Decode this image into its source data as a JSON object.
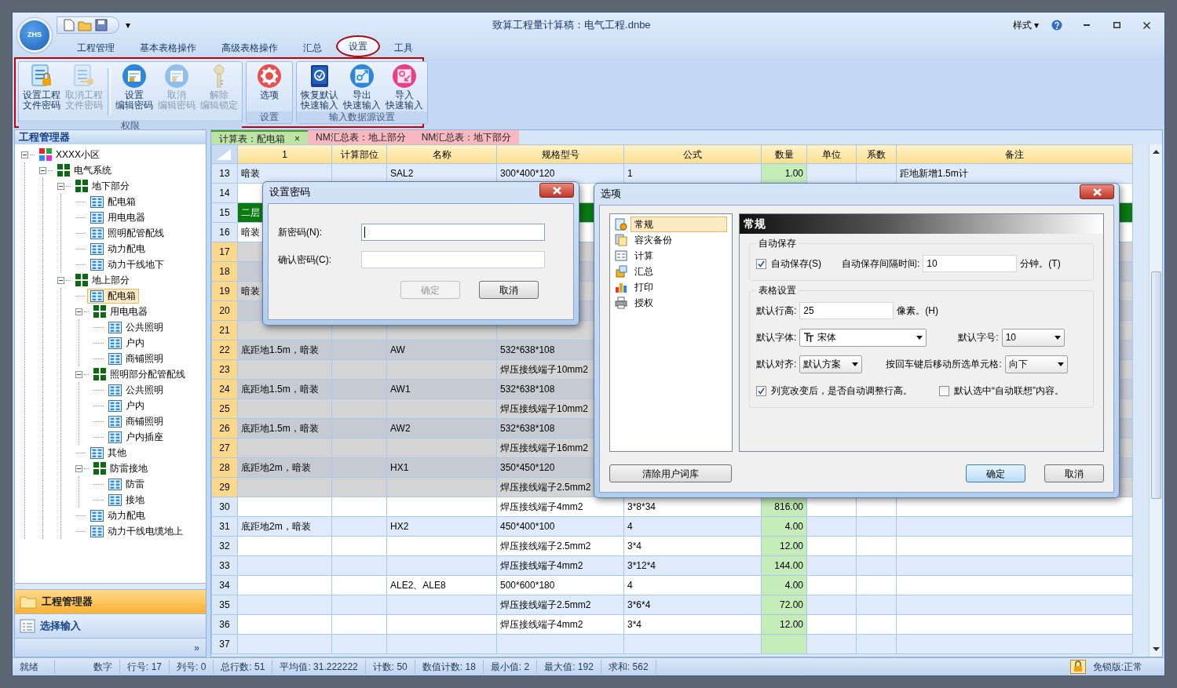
{
  "window": {
    "logo_text": "ZHS",
    "quick_access_more": "▾",
    "title": "致算工程量计算稿：电气工程.dnbe",
    "style_menu": "样式 ▾"
  },
  "ribbon_tabs": [
    {
      "label": "工程管理",
      "selected": false,
      "highlighted": false
    },
    {
      "label": "基本表格操作",
      "selected": false,
      "highlighted": false
    },
    {
      "label": "高级表格操作",
      "selected": false,
      "highlighted": false
    },
    {
      "label": "汇总",
      "selected": false,
      "highlighted": false
    },
    {
      "label": "设置",
      "selected": true,
      "highlighted": true
    },
    {
      "label": "工具",
      "selected": false,
      "highlighted": false
    }
  ],
  "ribbon": {
    "highlighted": true,
    "groups": [
      {
        "label": "权限",
        "buttons": [
          {
            "label": [
              "设置工程",
              "文件密码"
            ],
            "disabled": false
          },
          {
            "label": [
              "取消工程",
              "文件密码"
            ],
            "disabled": true
          },
          {
            "label": [
              "设置",
              "编辑密码"
            ],
            "disabled": false
          },
          {
            "label": [
              "取消",
              "编辑密码"
            ],
            "disabled": true
          },
          {
            "label": [
              "解除",
              "编辑锁定"
            ],
            "disabled": true
          }
        ]
      },
      {
        "label": "设置",
        "buttons": [
          {
            "label": [
              "选项"
            ],
            "disabled": false
          }
        ]
      },
      {
        "label": "输入数据源设置",
        "buttons": [
          {
            "label": [
              "恢复默认",
              "快速输入"
            ],
            "disabled": false
          },
          {
            "label": [
              "导出",
              "快速输入"
            ],
            "disabled": false
          },
          {
            "label": [
              "导入",
              "快速输入"
            ],
            "disabled": false
          }
        ]
      }
    ]
  },
  "sidebar": {
    "title": "工程管理器",
    "tree": [
      {
        "label": "XXXX小区",
        "kind": "project",
        "selected": false,
        "expanded": true,
        "children": [
          {
            "label": "电气系统",
            "kind": "group",
            "selected": false,
            "expanded": true,
            "children": [
              {
                "label": "地下部分",
                "kind": "group",
                "selected": false,
                "expanded": true,
                "children": [
                  {
                    "label": "配电箱",
                    "kind": "sheet",
                    "selected": false
                  },
                  {
                    "label": "用电电器",
                    "kind": "sheet",
                    "selected": false
                  },
                  {
                    "label": "照明配管配线",
                    "kind": "sheet",
                    "selected": false
                  },
                  {
                    "label": "动力配电",
                    "kind": "sheet",
                    "selected": false
                  },
                  {
                    "label": "动力干线地下",
                    "kind": "sheet",
                    "selected": false
                  }
                ]
              },
              {
                "label": "地上部分",
                "kind": "group",
                "selected": false,
                "expanded": true,
                "children": [
                  {
                    "label": "配电箱",
                    "kind": "sheet",
                    "selected": true
                  },
                  {
                    "label": "用电电器",
                    "kind": "group",
                    "selected": false,
                    "expanded": true,
                    "children": [
                      {
                        "label": "公共照明",
                        "kind": "sheet",
                        "selected": false
                      },
                      {
                        "label": "户内",
                        "kind": "sheet",
                        "selected": false
                      },
                      {
                        "label": "商铺照明",
                        "kind": "sheet",
                        "selected": false
                      }
                    ]
                  },
                  {
                    "label": "照明部分配管配线",
                    "kind": "group",
                    "selected": false,
                    "expanded": true,
                    "children": [
                      {
                        "label": "公共照明",
                        "kind": "sheet",
                        "selected": false
                      },
                      {
                        "label": "户内",
                        "kind": "sheet",
                        "selected": false
                      },
                      {
                        "label": "商铺照明",
                        "kind": "sheet",
                        "selected": false
                      },
                      {
                        "label": "户内插座",
                        "kind": "sheet",
                        "selected": false
                      }
                    ]
                  },
                  {
                    "label": "其他",
                    "kind": "sheet",
                    "selected": false
                  },
                  {
                    "label": "防雷接地",
                    "kind": "group",
                    "selected": false,
                    "expanded": true,
                    "children": [
                      {
                        "label": "防雷",
                        "kind": "sheet",
                        "selected": false
                      },
                      {
                        "label": "接地",
                        "kind": "sheet",
                        "selected": false
                      }
                    ]
                  },
                  {
                    "label": "动力配电",
                    "kind": "sheet",
                    "selected": false
                  },
                  {
                    "label": "动力干线电缆地上",
                    "kind": "sheet",
                    "selected": false
                  }
                ]
              }
            ]
          }
        ]
      }
    ],
    "nav": [
      {
        "label": "工程管理器",
        "selected": true
      },
      {
        "label": "选择输入",
        "selected": false
      }
    ],
    "more": "»"
  },
  "sheet_tabs": [
    {
      "label": "计算表：配电箱",
      "color": "#bfe3a5",
      "selected": true,
      "close": "×"
    },
    {
      "label": "NM汇总表：地上部分",
      "color": "#f7b8c0",
      "selected": false
    },
    {
      "label": "NM汇总表：地下部分",
      "color": "#f7b8c0",
      "selected": false
    }
  ],
  "grid": {
    "columns": [
      "1",
      "计算部位",
      "名称",
      "规格型号",
      "公式",
      "数量",
      "单位",
      "系数",
      "备注"
    ],
    "rows": [
      {
        "number": "13",
        "kind": "plain",
        "selected": false,
        "cells": [
          "暗装",
          null,
          "SAL2",
          "300*400*120",
          "1",
          "1.00",
          null,
          null,
          "距地新增1.5m计"
        ]
      },
      {
        "number": "14",
        "kind": "plain",
        "selected": false,
        "cells": [
          null,
          null,
          null,
          null,
          null,
          null,
          null,
          null,
          null
        ]
      },
      {
        "number": "15",
        "kind": "group",
        "selected": false,
        "cells": [
          "二层",
          null,
          null,
          null,
          null,
          null,
          null,
          null,
          null
        ]
      },
      {
        "number": "16",
        "kind": "plain",
        "selected": false,
        "cells": [
          "暗装",
          null,
          null,
          null,
          null,
          null,
          null,
          null,
          null
        ]
      },
      {
        "number": "17",
        "kind": "plain",
        "selected": true,
        "cells": [
          null,
          null,
          null,
          null,
          null,
          null,
          null,
          null,
          null
        ]
      },
      {
        "number": "18",
        "kind": "plain",
        "selected": true,
        "cells": [
          null,
          null,
          null,
          null,
          null,
          null,
          null,
          null,
          null
        ]
      },
      {
        "number": "19",
        "kind": "plain",
        "selected": true,
        "cells": [
          "暗装",
          null,
          null,
          null,
          null,
          null,
          null,
          null,
          null
        ]
      },
      {
        "number": "20",
        "kind": "plain",
        "selected": true,
        "cells": [
          null,
          null,
          null,
          null,
          null,
          null,
          null,
          null,
          null
        ]
      },
      {
        "number": "21",
        "kind": "plain",
        "selected": true,
        "cells": [
          null,
          null,
          null,
          null,
          null,
          null,
          null,
          null,
          null
        ]
      },
      {
        "number": "22",
        "kind": "plain",
        "selected": true,
        "cells": [
          "底距地1.5m，暗装",
          null,
          "AW",
          "532*638*108",
          null,
          null,
          null,
          null,
          null
        ]
      },
      {
        "number": "23",
        "kind": "plain",
        "selected": true,
        "cells": [
          null,
          null,
          null,
          "焊压接线端子10mm2",
          null,
          null,
          null,
          null,
          null
        ]
      },
      {
        "number": "24",
        "kind": "plain",
        "selected": true,
        "cells": [
          "底距地1.5m，暗装",
          null,
          "AW1",
          "532*638*108",
          null,
          null,
          null,
          null,
          null
        ]
      },
      {
        "number": "25",
        "kind": "plain",
        "selected": true,
        "cells": [
          null,
          null,
          null,
          "焊压接线端子10mm2",
          null,
          null,
          null,
          null,
          null
        ]
      },
      {
        "number": "26",
        "kind": "plain",
        "selected": true,
        "cells": [
          "底距地1.5m，暗装",
          null,
          "AW2",
          "532*638*108",
          null,
          null,
          null,
          null,
          null
        ]
      },
      {
        "number": "27",
        "kind": "plain",
        "selected": true,
        "cells": [
          null,
          null,
          null,
          "焊压接线端子16mm2",
          null,
          null,
          null,
          null,
          null
        ]
      },
      {
        "number": "28",
        "kind": "plain",
        "selected": true,
        "cells": [
          "底距地2m，暗装",
          null,
          "HX1",
          "350*450*120",
          null,
          null,
          null,
          null,
          null
        ]
      },
      {
        "number": "29",
        "kind": "plain",
        "selected": true,
        "cells": [
          null,
          null,
          null,
          "焊压接线端子2.5mm2",
          null,
          null,
          null,
          null,
          null
        ]
      },
      {
        "number": "30",
        "kind": "plain",
        "selected": false,
        "cells": [
          null,
          null,
          null,
          "焊压接线端子4mm2",
          "3*8*34",
          "816.00",
          null,
          null,
          null
        ]
      },
      {
        "number": "31",
        "kind": "plain",
        "selected": false,
        "cells": [
          "底距地2m，暗装",
          null,
          "HX2",
          "450*400*100",
          "4",
          "4.00",
          null,
          null,
          null
        ]
      },
      {
        "number": "32",
        "kind": "plain",
        "selected": false,
        "cells": [
          null,
          null,
          null,
          "焊压接线端子2.5mm2",
          "3*4",
          "12.00",
          null,
          null,
          null
        ]
      },
      {
        "number": "33",
        "kind": "plain",
        "selected": false,
        "cells": [
          null,
          null,
          null,
          "焊压接线端子4mm2",
          "3*12*4",
          "144.00",
          null,
          null,
          null
        ]
      },
      {
        "number": "34",
        "kind": "plain",
        "selected": false,
        "cells": [
          null,
          null,
          "ALE2、ALE8",
          "500*600*180",
          "4",
          "4.00",
          null,
          null,
          null
        ]
      },
      {
        "number": "35",
        "kind": "plain",
        "selected": false,
        "cells": [
          null,
          null,
          null,
          "焊压接线端子2.5mm2",
          "3*6*4",
          "72.00",
          null,
          null,
          null
        ]
      },
      {
        "number": "36",
        "kind": "plain",
        "selected": false,
        "cells": [
          null,
          null,
          null,
          "焊压接线端子4mm2",
          "3*4",
          "12.00",
          null,
          null,
          null
        ]
      },
      {
        "number": "37",
        "kind": "plain",
        "selected": false,
        "cells": [
          null,
          null,
          null,
          null,
          null,
          null,
          null,
          null,
          null
        ]
      }
    ]
  },
  "status_bar": {
    "items": [
      "就绪",
      "数字",
      "行号: 17",
      "列号: 0",
      "总行数: 51",
      "平均值: 31.222222",
      "计数: 50",
      "数值计数: 18",
      "最小值: 2",
      "最大值: 192",
      "求和: 562"
    ],
    "license": "免锁版:正常"
  },
  "password_dialog": {
    "title": "设置密码",
    "fields": [
      {
        "label": "新密码(N):",
        "focused": true
      },
      {
        "label": "确认密码(C):",
        "focused": false
      }
    ],
    "buttons": [
      {
        "label": "确定",
        "disabled": true
      },
      {
        "label": "取消",
        "disabled": false
      }
    ]
  },
  "options_dialog": {
    "title": "选项",
    "categories": [
      {
        "label": "常规",
        "selected": true
      },
      {
        "label": "容灾备份",
        "selected": false
      },
      {
        "label": "计算",
        "selected": false
      },
      {
        "label": "汇总",
        "selected": false
      },
      {
        "label": "打印",
        "selected": false
      },
      {
        "label": "授权",
        "selected": false
      }
    ],
    "panel_title": "常规",
    "groups": [
      {
        "title": "自动保存",
        "rows": [
          {
            "items": [
              {
                "kind": "checkbox",
                "label": "自动保存(S)",
                "checked": true
              },
              {
                "kind": "label",
                "text": "自动保存间隔时间:"
              },
              {
                "kind": "input",
                "value": "10"
              },
              {
                "kind": "label",
                "text": "分钟。(T)"
              }
            ]
          }
        ]
      },
      {
        "title": "表格设置",
        "rows": [
          {
            "items": [
              {
                "kind": "label",
                "text": "默认行高:"
              },
              {
                "kind": "input",
                "value": "25"
              },
              {
                "kind": "label",
                "text": "像素。(H)"
              }
            ]
          },
          {
            "items": [
              {
                "kind": "label",
                "text": "默认字体:"
              },
              {
                "kind": "font_select",
                "value": "宋体"
              },
              {
                "kind": "label",
                "text": "默认字号:"
              },
              {
                "kind": "select",
                "value": "10"
              }
            ]
          },
          {
            "items": [
              {
                "kind": "label",
                "text": "默认对齐:"
              },
              {
                "kind": "select",
                "value": "默认方案"
              },
              {
                "kind": "label",
                "text": "按回车键后移动所选单元格:"
              },
              {
                "kind": "select",
                "value": "向下"
              }
            ]
          },
          {
            "items": [
              {
                "kind": "checkbox",
                "label": "列宽改变后，是否自动调整行高。",
                "checked": true
              },
              {
                "kind": "checkbox",
                "label": "默认选中“自动联想”内容。",
                "checked": false
              }
            ]
          }
        ]
      }
    ],
    "buttons": [
      {
        "label": "清除用户词库",
        "default": false
      },
      {
        "label": "确定",
        "default": true
      },
      {
        "label": "取消",
        "default": false
      }
    ]
  }
}
